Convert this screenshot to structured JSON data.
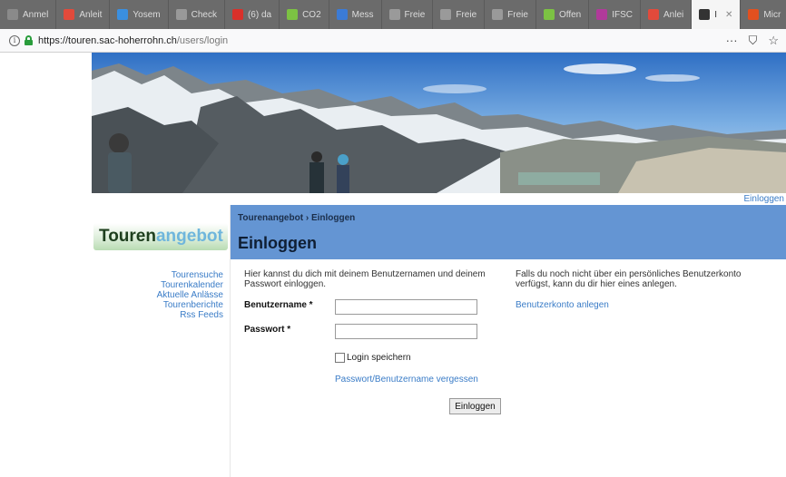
{
  "browser": {
    "tabs": [
      {
        "label": "Anmel",
        "icon": "page-icon",
        "color": "#8a8a8a",
        "active": false
      },
      {
        "label": "Anleit",
        "icon": "sac-icon",
        "color": "#e24a3b",
        "active": false
      },
      {
        "label": "Yosem",
        "icon": "image-icon",
        "color": "#3a8fe0",
        "active": false
      },
      {
        "label": "Check",
        "icon": "globe-icon",
        "color": "#999999",
        "active": false
      },
      {
        "label": "(6) da",
        "icon": "video-icon",
        "color": "#d9302a",
        "active": false
      },
      {
        "label": "CO2",
        "icon": "leaf-icon",
        "color": "#7cc243",
        "active": false
      },
      {
        "label": "Mess",
        "icon": "chat-icon",
        "color": "#3b7bd6",
        "active": false
      },
      {
        "label": "Freie",
        "icon": "doc-icon",
        "color": "#9a9a9a",
        "active": false
      },
      {
        "label": "Freie",
        "icon": "doc-icon",
        "color": "#9a9a9a",
        "active": false
      },
      {
        "label": "Freie",
        "icon": "doc-icon",
        "color": "#9a9a9a",
        "active": false
      },
      {
        "label": "Offen",
        "icon": "check-icon",
        "color": "#7cc243",
        "active": false
      },
      {
        "label": "IFSC",
        "icon": "circle-icon",
        "color": "#b03a9a",
        "active": false
      },
      {
        "label": "Anlei",
        "icon": "sac-icon",
        "color": "#e24a3b",
        "active": false
      },
      {
        "label": "I",
        "icon": "brand-icon",
        "color": "#333333",
        "active": true
      },
      {
        "label": "Micr",
        "icon": "office-icon",
        "color": "#e2501f",
        "active": false
      }
    ],
    "url_host": "https://touren.sac-hoherrohn.ch",
    "url_path": "/users/login",
    "info_glyph": "i",
    "menu_glyph": "···",
    "pocket_glyph": "⛉",
    "star_glyph": "☆"
  },
  "top_login_link": "Einloggen",
  "logo": {
    "part1": "Touren",
    "part2": "angebot"
  },
  "nav": {
    "items": [
      "Tourensuche",
      "Tourenkalender",
      "Aktuelle Anlässe",
      "Tourenberichte",
      "Rss Feeds"
    ]
  },
  "header": {
    "breadcrumb_root": "Tourenangebot",
    "breadcrumb_sep": "›",
    "breadcrumb_current": "Einloggen",
    "title": "Einloggen"
  },
  "form": {
    "intro": "Hier kannst du dich mit deinem Benutzernamen und deinem Passwort einloggen.",
    "username_label": "Benutzername *",
    "username_value": "",
    "password_label": "Passwort *",
    "password_value": "",
    "remember_label": "Login speichern",
    "remember_checked": false,
    "forgot_link": "Passwort/Benutzername vergessen",
    "submit_label": "Einloggen"
  },
  "sidebar_note": {
    "text": "Falls du noch nicht über ein persönliches Benutzerkonto verfügst, kann du dir hier eines anlegen.",
    "create_link": "Benutzerkonto anlegen"
  },
  "colors": {
    "header_blue": "#6495d3",
    "link_blue": "#3a7cc7"
  }
}
